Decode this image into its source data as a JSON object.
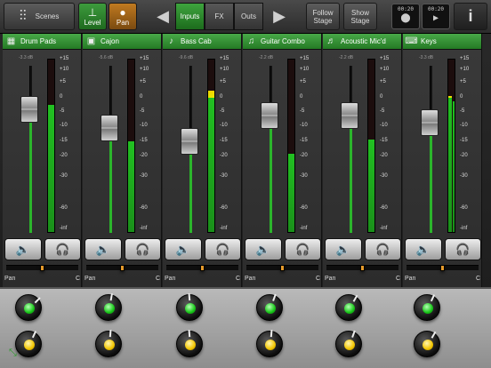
{
  "toolbar": {
    "scenes_label": "Scenes",
    "level_label": "Level",
    "pan_label": "Pan",
    "tabs": [
      {
        "label": "Inputs",
        "active": true
      },
      {
        "label": "FX",
        "active": false
      },
      {
        "label": "Outs",
        "active": false
      }
    ],
    "follow_stage_label": "Follow\nStage",
    "show_stage_label": "Show\nStage",
    "record_time": "00:20",
    "play_time": "00:20",
    "info_label": "i",
    "icons": [
      "mixer-icon",
      "fader-icon",
      "microphone-icon",
      "arrow-left-icon",
      "arrow-right-icon",
      "record-icon",
      "play-icon",
      "info-icon"
    ]
  },
  "channels": [
    {
      "name": "Drum Pads",
      "icon": "drum-pads-icon",
      "db": "-3.3 dB",
      "fader": 0.74,
      "meter": [
        0.74
      ],
      "pan": 0.5,
      "pan_left": "Pan",
      "pan_right": "C"
    },
    {
      "name": "Cajon",
      "icon": "cajon-icon",
      "db": "-5.6 dB",
      "fader": 0.63,
      "meter": [
        0.53
      ],
      "pan": 0.5,
      "pan_left": "Pan",
      "pan_right": "C"
    },
    {
      "name": "Bass Cab",
      "icon": "bass-guitar-icon",
      "db": "-9.6 dB",
      "fader": 0.55,
      "meter": [
        0.82
      ],
      "pan": 0.5,
      "pan_left": "Pan",
      "pan_right": "C"
    },
    {
      "name": "Guitar Combo",
      "icon": "guitar-icon",
      "db": "-2.2 dB",
      "fader": 0.7,
      "meter": [
        0.46
      ],
      "pan": 0.5,
      "pan_left": "Pan",
      "pan_right": "C"
    },
    {
      "name": "Acoustic Mic'd",
      "icon": "acoustic-guitar-icon",
      "db": "-2.2 dB",
      "fader": 0.7,
      "meter": [
        0.54
      ],
      "pan": 0.5,
      "pan_left": "Pan",
      "pan_right": "C"
    },
    {
      "name": "Keys",
      "icon": "keyboard-icon",
      "db": "-3.3 dB",
      "fader": 0.66,
      "meter": [
        0.79,
        0.76
      ],
      "pan": 0.5,
      "pan_left": "Pan",
      "pan_right": "C"
    }
  ],
  "meter_scale": [
    "+15",
    "+10",
    "+5",
    "0",
    "-5",
    "-10",
    "-15",
    "-20",
    "-30",
    "-60",
    "-inf"
  ],
  "buttons": {
    "mute_icon": "speaker-icon",
    "headphone_icon": "headphones-icon"
  },
  "knobs": {
    "top_color": "#1fcc1f",
    "bottom_color": "#f2c500",
    "top_angles": [
      45,
      10,
      -5,
      20,
      30,
      25
    ],
    "bottom_angles": [
      25,
      5,
      -5,
      5,
      20,
      30
    ]
  },
  "resize_icon": "resize-icon",
  "colors": {
    "accent_green": "#2d9a2d",
    "knob_green": "#1fcc1f",
    "knob_yellow": "#f2c500",
    "pan_orange": "#e59a2a"
  }
}
